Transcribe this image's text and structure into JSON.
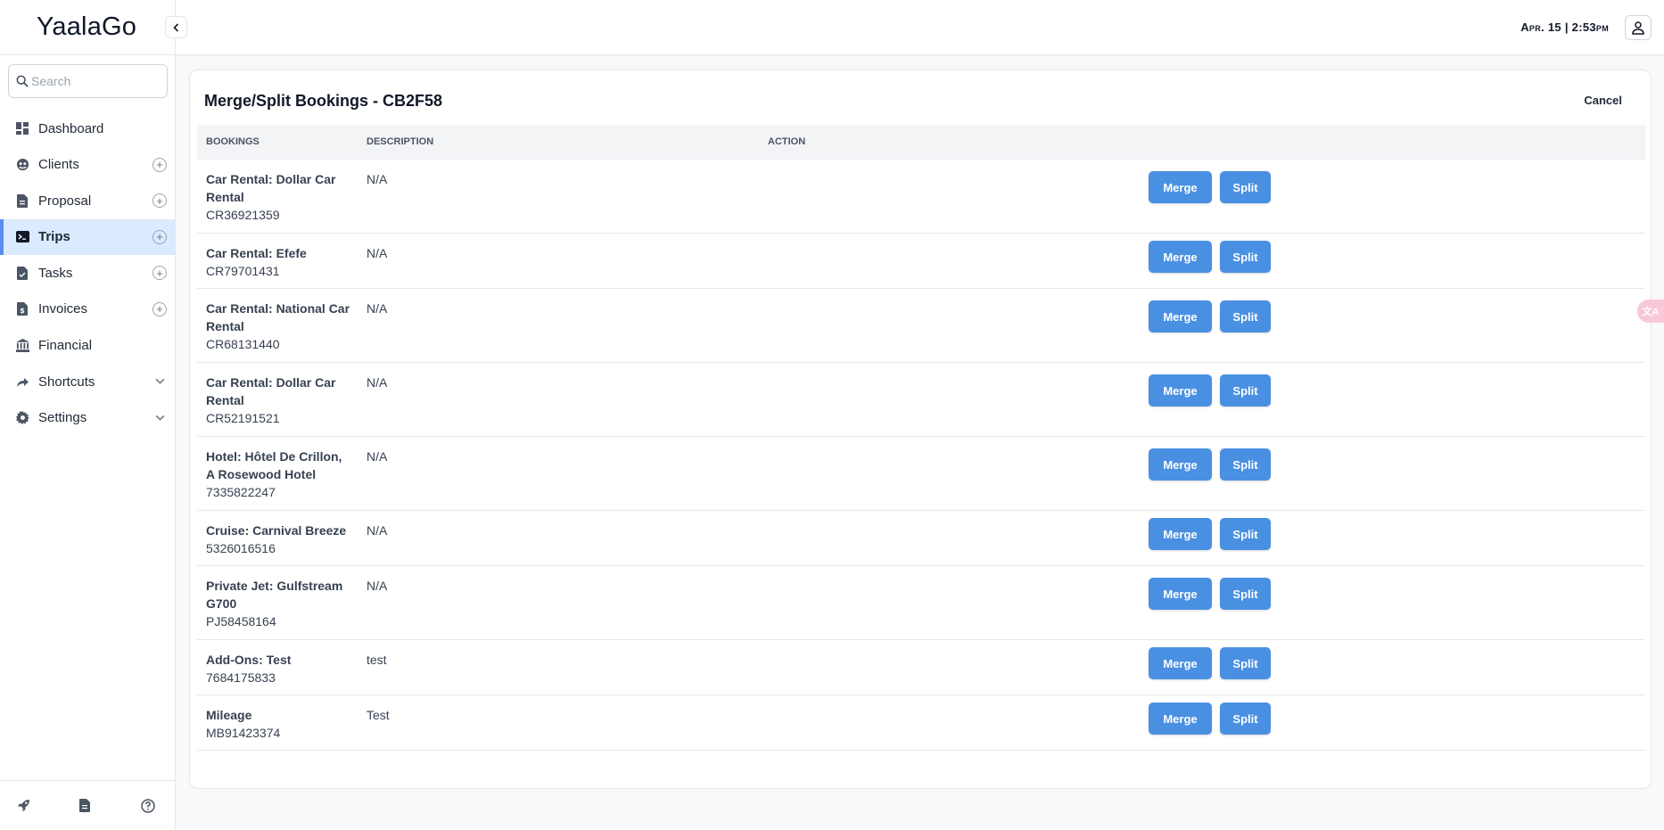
{
  "app": {
    "title": "YaalaGo"
  },
  "search": {
    "placeholder": "Search"
  },
  "sidebar": {
    "items": [
      {
        "label": "Dashboard",
        "icon": "dashboard-icon",
        "has_plus": false,
        "has_chevron": false,
        "active": false
      },
      {
        "label": "Clients",
        "icon": "clients-icon",
        "has_plus": true,
        "has_chevron": false,
        "active": false
      },
      {
        "label": "Proposal",
        "icon": "document-icon",
        "has_plus": true,
        "has_chevron": false,
        "active": false
      },
      {
        "label": "Trips",
        "icon": "terminal-icon",
        "has_plus": true,
        "has_chevron": false,
        "active": true
      },
      {
        "label": "Tasks",
        "icon": "task-icon",
        "has_plus": true,
        "has_chevron": false,
        "active": false
      },
      {
        "label": "Invoices",
        "icon": "invoice-icon",
        "has_plus": true,
        "has_chevron": false,
        "active": false
      },
      {
        "label": "Financial",
        "icon": "bank-icon",
        "has_plus": false,
        "has_chevron": false,
        "active": false
      },
      {
        "label": "Shortcuts",
        "icon": "share-arrow-icon",
        "has_plus": false,
        "has_chevron": true,
        "active": false
      },
      {
        "label": "Settings",
        "icon": "gear-icon",
        "has_plus": false,
        "has_chevron": true,
        "active": false
      }
    ],
    "footer_icons": [
      "rocket-icon",
      "file-icon",
      "help-icon"
    ]
  },
  "header": {
    "date": "Apr. 15",
    "separator": "|",
    "time": "2:53pm"
  },
  "page": {
    "title": "Merge/Split Bookings - CB2F58",
    "cancel_label": "Cancel",
    "columns": [
      "BOOKINGS",
      "DESCRIPTION",
      "ACTION"
    ],
    "merge_label": "Merge",
    "split_label": "Split",
    "rows": [
      {
        "name": "Car Rental: Dollar Car Rental",
        "code": "CR36921359",
        "description": "N/A"
      },
      {
        "name": "Car Rental: Efefe",
        "code": "CR79701431",
        "description": "N/A"
      },
      {
        "name": "Car Rental: National Car Rental",
        "code": "CR68131440",
        "description": "N/A"
      },
      {
        "name": "Car Rental: Dollar Car Rental",
        "code": "CR52191521",
        "description": "N/A"
      },
      {
        "name": "Hotel: Hôtel De Crillon, A Rosewood Hotel",
        "code": "7335822247",
        "description": "N/A"
      },
      {
        "name": "Cruise: Carnival Breeze",
        "code": "5326016516",
        "description": "N/A"
      },
      {
        "name": "Private Jet: Gulfstream G700",
        "code": "PJ58458164",
        "description": "N/A"
      },
      {
        "name": "Add-Ons: Test",
        "code": "7684175833",
        "description": "test"
      },
      {
        "name": "Mileage",
        "code": "MB91423374",
        "description": "Test"
      }
    ]
  },
  "colors": {
    "accent": "#4a90e2",
    "active_nav_bg": "#dbeafe",
    "active_nav_bar": "#5b8def"
  }
}
